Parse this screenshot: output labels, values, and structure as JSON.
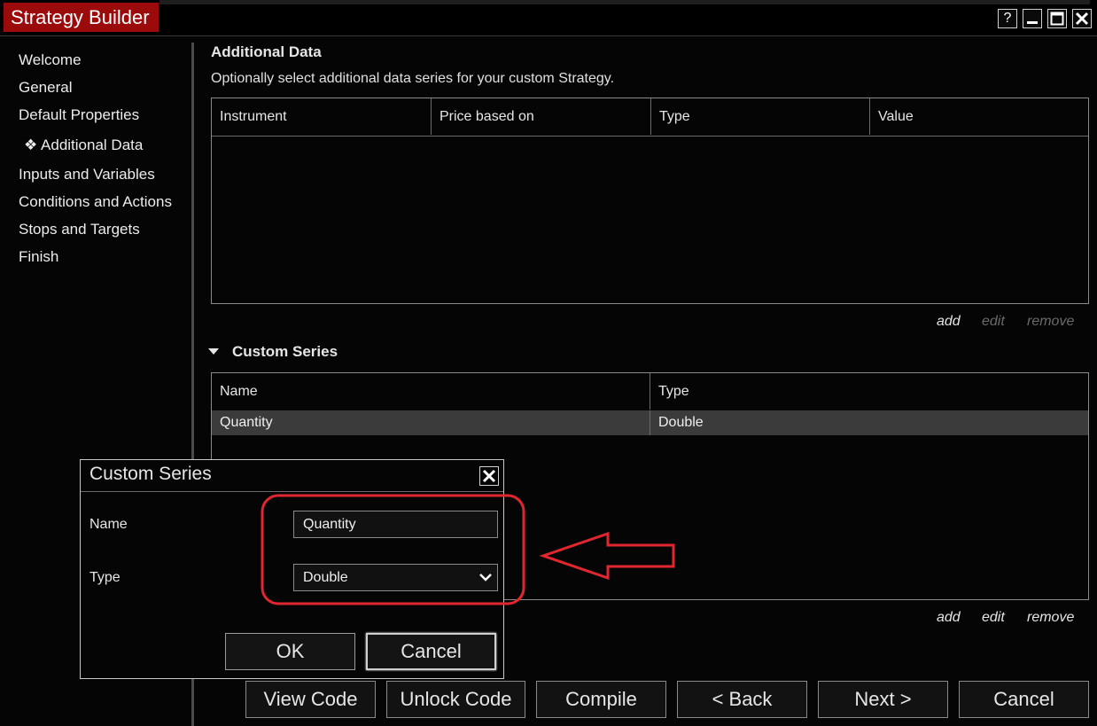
{
  "window": {
    "title": "Strategy Builder",
    "controls": {
      "help": "?",
      "minimize": "▁",
      "maximize": "□",
      "close": "✕"
    }
  },
  "sidebar": {
    "items": [
      {
        "label": "Welcome"
      },
      {
        "label": "General"
      },
      {
        "label": "Default Properties"
      },
      {
        "label": "❖ Additional Data",
        "active": true
      },
      {
        "label": "Inputs and Variables"
      },
      {
        "label": "Conditions and Actions"
      },
      {
        "label": "Stops and Targets"
      },
      {
        "label": "Finish"
      }
    ]
  },
  "main": {
    "title": "Additional Data",
    "description": "Optionally select additional data series for your custom Strategy.",
    "data_grid": {
      "columns": [
        "Instrument",
        "Price based on",
        "Type",
        "Value"
      ],
      "rows": []
    },
    "data_actions": {
      "add": "add",
      "edit": "edit",
      "remove": "remove"
    },
    "custom_series": {
      "title": "Custom Series",
      "columns": [
        "Name",
        "Type"
      ],
      "rows": [
        {
          "name": "Quantity",
          "type": "Double"
        }
      ],
      "actions": {
        "add": "add",
        "edit": "edit",
        "remove": "remove"
      }
    }
  },
  "footer": {
    "buttons": [
      "View Code",
      "Unlock Code",
      "Compile",
      "< Back",
      "Next >",
      "Cancel"
    ]
  },
  "dialog": {
    "title": "Custom Series",
    "close": "✕",
    "name_label": "Name",
    "name_value": "Quantity",
    "type_label": "Type",
    "type_value": "Double",
    "ok": "OK",
    "cancel": "Cancel"
  },
  "annotation": {
    "highlight_color": "#e0262e"
  }
}
